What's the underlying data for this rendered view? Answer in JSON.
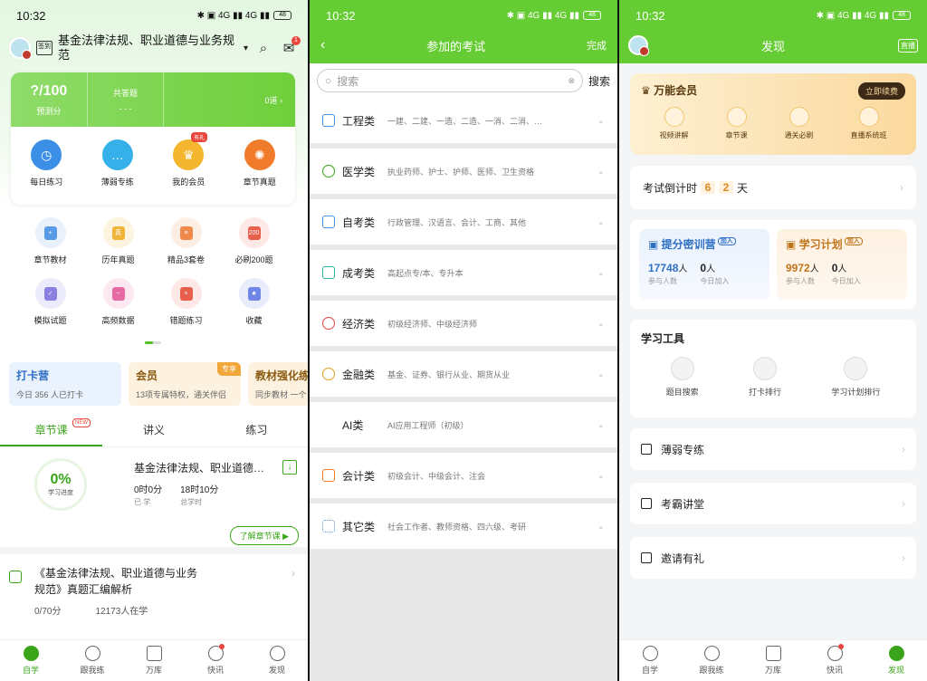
{
  "status": {
    "time": "10:32",
    "battery": "48"
  },
  "p1": {
    "header_title": "基金法律法规、职业道德与业务规范",
    "checkin": "签到",
    "msg_badge": "1",
    "score": "?/100",
    "score_label": "预测分",
    "answered_label": "共答题",
    "answered_value": "- - -",
    "answered_count": "0道 ›",
    "main_icons": [
      {
        "label": "每日练习",
        "tag": ""
      },
      {
        "label": "薄弱专练",
        "tag": ""
      },
      {
        "label": "我的会员",
        "tag": "有礼"
      },
      {
        "label": "章节真题",
        "tag": ""
      }
    ],
    "grid": [
      "章节教材",
      "历年真题",
      "精品3套卷",
      "必刷200题",
      "模拟试题",
      "高频数据",
      "错题练习",
      "收藏"
    ],
    "grid_badge": "200",
    "promos": [
      {
        "title": "打卡营",
        "sub": "今日 356 人已打卡",
        "badge": ""
      },
      {
        "title": "会员",
        "sub": "13项专属特权，通关伴侣",
        "badge": "专享"
      },
      {
        "title": "教材强化练",
        "sub": "同步教材 一个",
        "badge": ""
      }
    ],
    "tabs": [
      "章节课",
      "讲义",
      "练习"
    ],
    "new_tag": "NEW",
    "course": {
      "progress": "0%",
      "progress_label": "学习进度",
      "title": "基金法律法规、职业道德与业务规范",
      "studied": "0时0分",
      "studied_label": "已 学",
      "total": "18时10分",
      "total_label": "总学时",
      "action": "了解章节课 ▶"
    },
    "book": {
      "title": "《基金法律法规、职业道德与业务规范》真题汇编解析",
      "score": "0/70分",
      "learners": "12173人在学"
    },
    "nav": [
      "自学",
      "跟我练",
      "万库",
      "快讯",
      "发现"
    ]
  },
  "p2": {
    "title": "参加的考试",
    "done": "完成",
    "search_placeholder": "搜索",
    "search_btn": "搜索",
    "cats": [
      {
        "name": "工程类",
        "desc": "一建、二建、一造、二造、一消、二消、…",
        "color": "#4a90d9"
      },
      {
        "name": "医学类",
        "desc": "执业药师、护士、护师、医师、卫生资格",
        "color": "#3aa51a"
      },
      {
        "name": "自考类",
        "desc": "行政管理、汉语言、会计、工商、其他",
        "color": "#4a90d9"
      },
      {
        "name": "成考类",
        "desc": "高起点专/本、专升本",
        "color": "#2bb3a3"
      },
      {
        "name": "经济类",
        "desc": "初级经济师、中级经济师",
        "color": "#e8453c"
      },
      {
        "name": "金融类",
        "desc": "基金、证券、银行从业、期货从业",
        "color": "#e0a21e"
      },
      {
        "name": "AI类",
        "desc": "AI应用工程师（初级）",
        "color": ""
      },
      {
        "name": "会计类",
        "desc": "初级会计、中级会计、注会",
        "color": "#f07b2a"
      },
      {
        "name": "其它类",
        "desc": "社会工作者、教师资格、四六级、考研",
        "color": "#4a90d9"
      }
    ]
  },
  "p3": {
    "title": "发现",
    "live": "直播",
    "vip_title": "万能会员",
    "renew": "立即续费",
    "vip_items": [
      "视频讲解",
      "章节课",
      "通关必刷",
      "直播系统班"
    ],
    "countdown_label": "考试倒计时",
    "countdown_d1": "6",
    "countdown_d2": "2",
    "countdown_unit": "天",
    "camps": [
      {
        "title": "提分密训营",
        "add": "加入",
        "n1": "17748",
        "u1": "人",
        "l1": "参与人数",
        "n2": "0",
        "u2": "人",
        "l2": "今日加入"
      },
      {
        "title": "学习计划",
        "add": "加入",
        "n1": "9972",
        "u1": "人",
        "l1": "参与人数",
        "n2": "0",
        "u2": "人",
        "l2": "今日加入"
      }
    ],
    "tools_title": "学习工具",
    "tools": [
      "题目搜索",
      "打卡排行",
      "学习计划排行"
    ],
    "rows": [
      "薄弱专练",
      "考霸讲堂",
      "邀请有礼"
    ],
    "nav": [
      "自学",
      "跟我练",
      "万库",
      "快讯",
      "发现"
    ]
  }
}
